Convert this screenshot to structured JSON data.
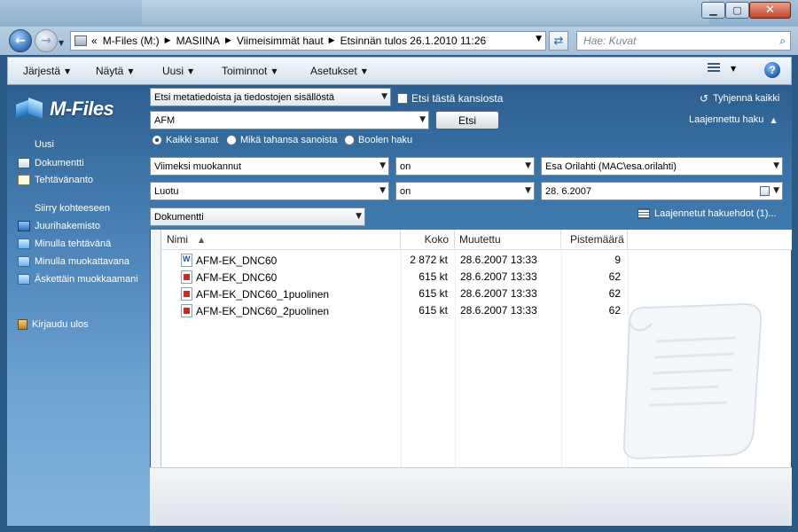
{
  "window": {
    "controls": {
      "minimize": "▁",
      "maximize": "▢",
      "close": "✕"
    }
  },
  "address_bar": {
    "overflow_marker": "«",
    "crumbs": [
      "M-Files (M:)",
      "MASIINA",
      "Viimeisimmät haut",
      "Etsinnän tulos 26.1.2010 11:26"
    ],
    "search_placeholder": "Hae: Kuvat"
  },
  "command_bar": {
    "items": [
      "Järjestä",
      "Näytä",
      "Uusi",
      "Toiminnot",
      "Asetukset"
    ],
    "help": "?"
  },
  "left_pane": {
    "logo": "M-Files",
    "new_heading": "Uusi",
    "new_items": [
      {
        "label": "Dokumentti",
        "icon": "document-icon"
      },
      {
        "label": "Tehtävänanto",
        "icon": "task-icon"
      }
    ],
    "goto_heading": "Siirry kohteeseen",
    "goto_items": [
      {
        "label": "Juurihakemisto",
        "icon": "home-icon"
      },
      {
        "label": "Minulla tehtävänä",
        "icon": "folder-icon"
      },
      {
        "label": "Minulla muokattavana",
        "icon": "folder-icon"
      },
      {
        "label": "Äskettäin muokkaamani",
        "icon": "folder-icon"
      }
    ],
    "logout": "Kirjaudu ulos"
  },
  "search_panel": {
    "scope": "Etsi metatiedoista ja tiedostojen sisällöstä",
    "this_folder": "Etsi tästä kansiosta",
    "query": "AFM",
    "search_button": "Etsi",
    "radios": [
      {
        "label": "Kaikki sanat",
        "selected": true
      },
      {
        "label": "Mikä tahansa sanoista",
        "selected": false
      },
      {
        "label": "Boolen haku",
        "selected": false
      }
    ],
    "clear_all": "Tyhjennä kaikki",
    "advanced_search": "Laajennettu haku",
    "conditions": [
      {
        "property": "Viimeksi muokannut",
        "operator": "on",
        "value": "Esa Orilahti (MAC\\esa.orilahti)"
      },
      {
        "property": "Luotu",
        "operator": "on",
        "value": "28.  6.2007"
      }
    ],
    "object_type": "Dokumentti",
    "advanced_conditions": "Laajennetut hakuehdot (1)..."
  },
  "results": {
    "columns": [
      "Nimi",
      "Koko",
      "Muutettu",
      "Pistemäärä"
    ],
    "rows": [
      {
        "name": "AFM-EK_DNC60",
        "type": "word",
        "size": "2 872 kt",
        "modified": "28.6.2007 13:33",
        "score": "9"
      },
      {
        "name": "AFM-EK_DNC60",
        "type": "pdf",
        "size": "615 kt",
        "modified": "28.6.2007 13:33",
        "score": "62"
      },
      {
        "name": "AFM-EK_DNC60_1puolinen",
        "type": "pdf",
        "size": "615 kt",
        "modified": "28.6.2007 13:33",
        "score": "62"
      },
      {
        "name": "AFM-EK_DNC60_2puolinen",
        "type": "pdf",
        "size": "615 kt",
        "modified": "28.6.2007 13:33",
        "score": "62"
      }
    ]
  },
  "colors": {
    "pane_blue": "#3a73a7",
    "title_blue": "#a9c3da",
    "close_red": "#c0452a"
  }
}
